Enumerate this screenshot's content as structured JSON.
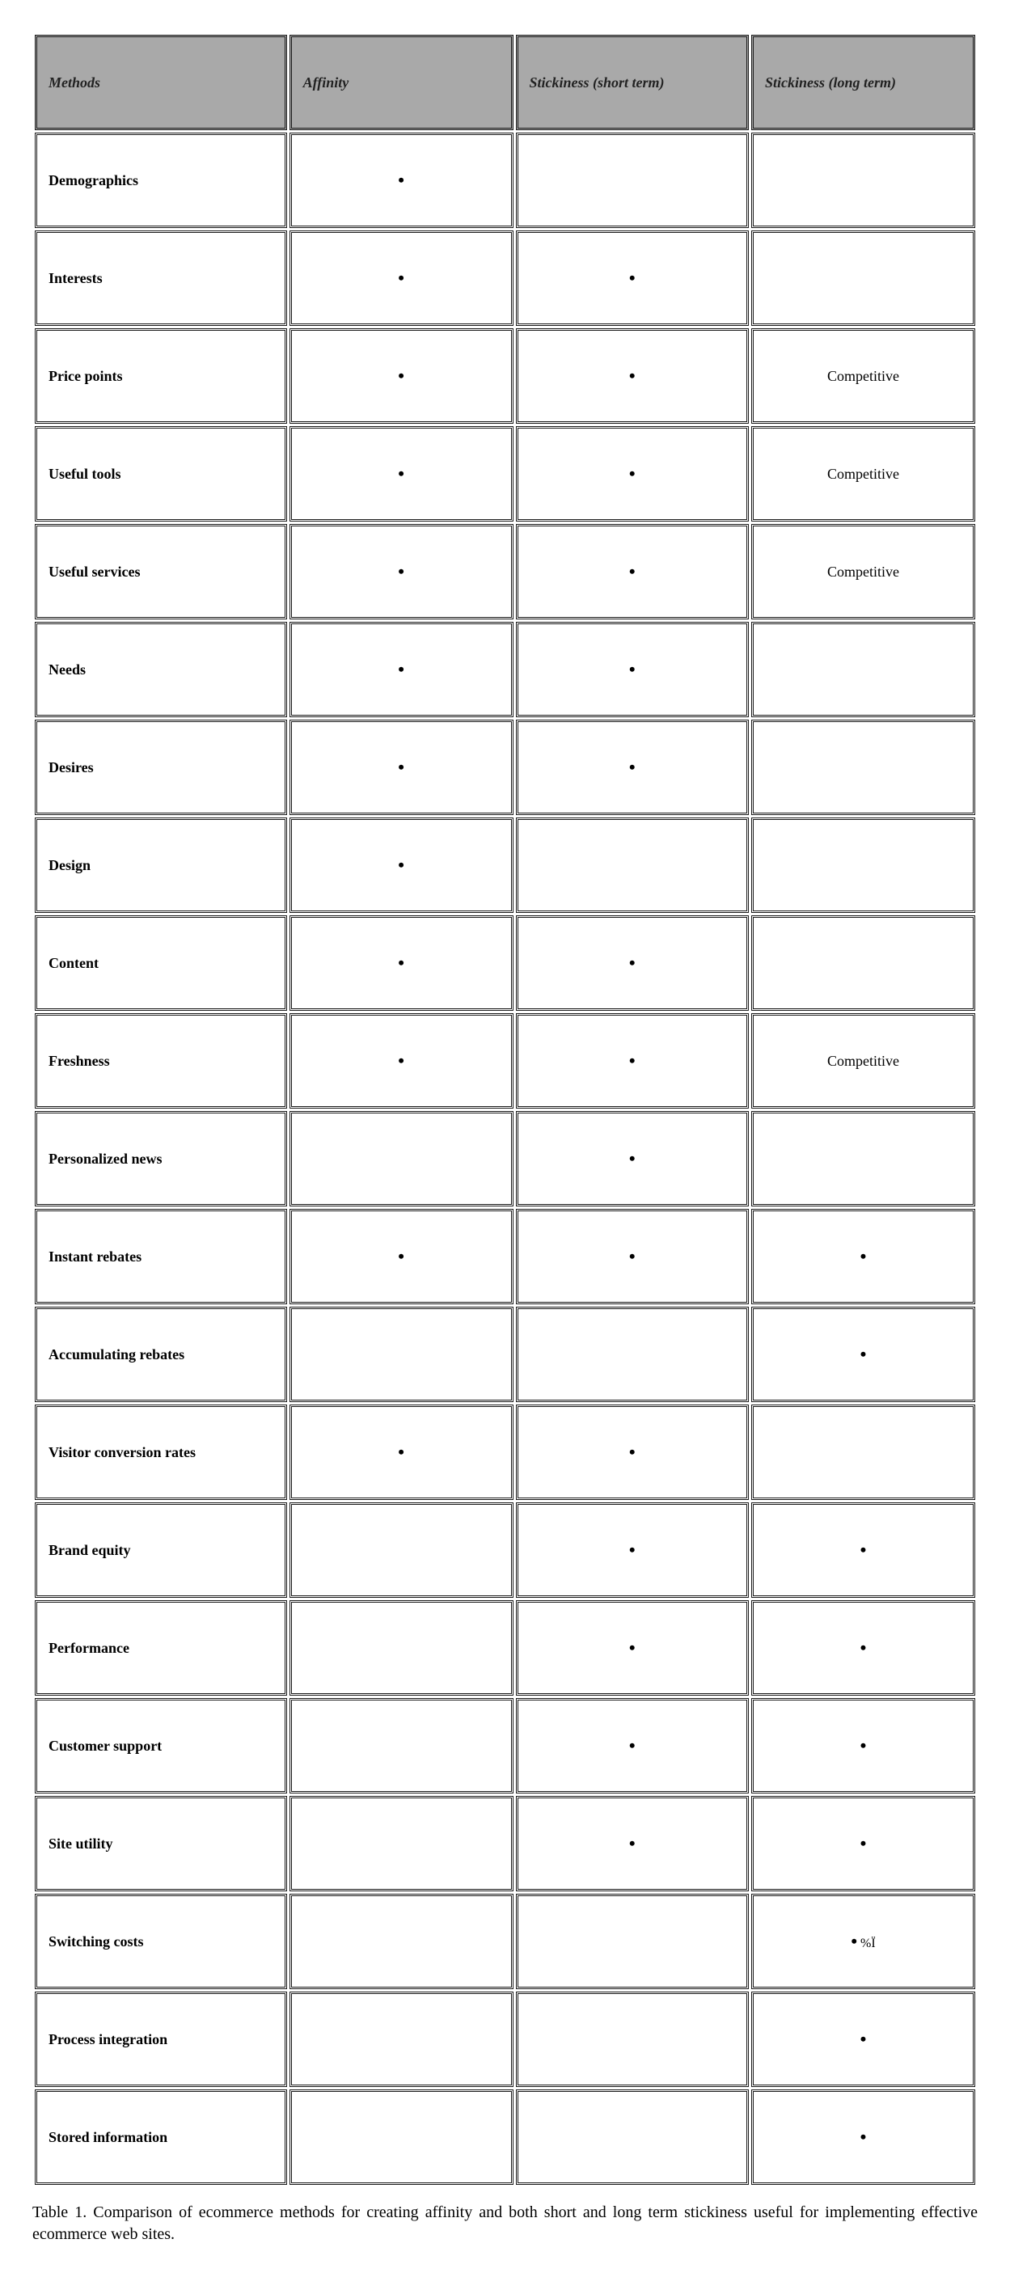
{
  "headers": {
    "methods": "Methods",
    "affinity": "Affinity",
    "short": "Stickiness (short term)",
    "long": "Stickiness (long term)"
  },
  "rows": [
    {
      "method": "Demographics",
      "affinity": "•",
      "short": "",
      "long": ""
    },
    {
      "method": "Interests",
      "affinity": "•",
      "short": "•",
      "long": ""
    },
    {
      "method": "Price points",
      "affinity": "•",
      "short": "•",
      "long": "Competitive"
    },
    {
      "method": "Useful tools",
      "affinity": "•",
      "short": "•",
      "long": "Competitive"
    },
    {
      "method": "Useful services",
      "affinity": "•",
      "short": "•",
      "long": "Competitive"
    },
    {
      "method": "Needs",
      "affinity": "•",
      "short": "•",
      "long": ""
    },
    {
      "method": "Desires",
      "affinity": "•",
      "short": "•",
      "long": ""
    },
    {
      "method": "Design",
      "affinity": "•",
      "short": "",
      "long": ""
    },
    {
      "method": "Content",
      "affinity": "•",
      "short": "•",
      "long": ""
    },
    {
      "method": "Freshness",
      "affinity": "•",
      "short": "•",
      "long": "Competitive"
    },
    {
      "method": "Personalized news",
      "affinity": "",
      "short": "•",
      "long": ""
    },
    {
      "method": "Instant rebates",
      "affinity": "•",
      "short": "•",
      "long": "•"
    },
    {
      "method": "Accumulating rebates",
      "affinity": "",
      "short": "",
      "long": "•"
    },
    {
      "method": "Visitor conversion rates",
      "affinity": "•",
      "short": "•",
      "long": ""
    },
    {
      "method": "Brand equity",
      "affinity": "",
      "short": "•",
      "long": "•"
    },
    {
      "method": "Performance",
      "affinity": "",
      "short": "•",
      "long": "•"
    },
    {
      "method": "Customer support",
      "affinity": "",
      "short": "•",
      "long": "•"
    },
    {
      "method": "Site utility",
      "affinity": "",
      "short": "•",
      "long": "•"
    },
    {
      "method": "Switching costs",
      "affinity": "",
      "short": "",
      "long": "•  %Ï"
    },
    {
      "method": "Process integration",
      "affinity": "",
      "short": "",
      "long": "•"
    },
    {
      "method": "Stored information",
      "affinity": "",
      "short": "",
      "long": "•"
    }
  ],
  "caption": "Table 1. Comparison of ecommerce methods for creating affinity and both short and long term stickiness useful for implementing effective ecommerce web sites."
}
